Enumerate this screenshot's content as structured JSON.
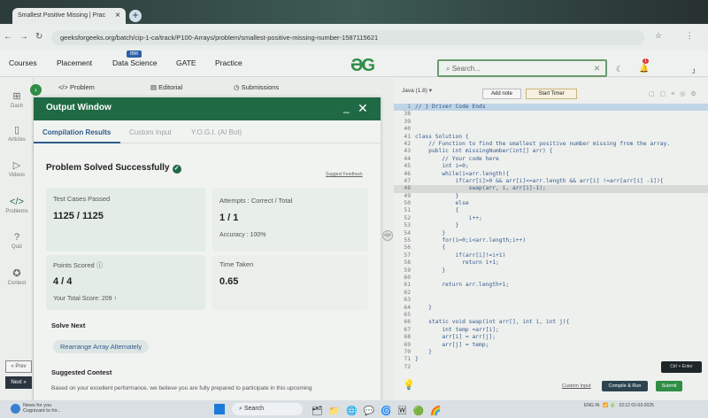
{
  "browser": {
    "tab_title": "Smallest Positive Missing | Prac",
    "url": "geeksforgeeks.org/batch/cip-1-ca/track/P100-Arrays/problem/smallest-positive-missing-number-1587115621"
  },
  "topnav": {
    "items": [
      "Courses",
      "Placement",
      "Data Science",
      "GATE",
      "Practice"
    ],
    "ibm_badge": "IBM",
    "logo": "ƏG",
    "search_placeholder": "Search...",
    "notif_count": "1",
    "avatar": "J"
  },
  "sidebar": {
    "items": [
      "Dash",
      "Articles",
      "Videos",
      "Problems",
      "Quiz",
      "Contest"
    ],
    "prev": "« Prev",
    "next": "Next »"
  },
  "problem_tabs": [
    "Problem",
    "Editorial",
    "Submissions"
  ],
  "output": {
    "title": "Output Window",
    "tabs": [
      "Compilation Results",
      "Custom Input",
      "Y.O.G.I. (AI Bot)"
    ],
    "status": "Problem Solved Successfully",
    "feedback": "Suggest Feedback",
    "test_cases_label": "Test Cases Passed",
    "test_cases": "1125 / 1125",
    "attempts_label": "Attempts : Correct / Total",
    "attempts": "1 / 1",
    "accuracy": "Accuracy : 100%",
    "points_label": "Points Scored",
    "points": "4 / 4",
    "total_score": "Your Total Score: 209 ↑",
    "time_label": "Time Taken",
    "time": "0.65",
    "solve_next": "Solve Next",
    "next_problem": "Rearrange Array Alternately",
    "suggested": "Suggested Contest",
    "suggested_text": "Based on your excellent performance, we believe you are fully prepared to participate in this upcoming"
  },
  "editor": {
    "language": "Java (1.8)",
    "add_note": "Add note",
    "start_timer": "Start Timer",
    "lines": [
      {
        "n": "1",
        "t": "// } Driver Code Ends"
      },
      {
        "n": "38",
        "t": ""
      },
      {
        "n": "39",
        "t": ""
      },
      {
        "n": "40",
        "t": ""
      },
      {
        "n": "41",
        "t": "class Solution {"
      },
      {
        "n": "42",
        "t": "    // Function to find the smallest positive number missing from the array."
      },
      {
        "n": "43",
        "t": "    public int missingNumber(int[] arr) {"
      },
      {
        "n": "44",
        "t": "        // Your code here"
      },
      {
        "n": "45",
        "t": "        int i=0;"
      },
      {
        "n": "46",
        "t": "        while(i<arr.length){"
      },
      {
        "n": "47",
        "t": "            if(arr[i]>0 && arr[i]<=arr.length && arr[i] !=arr[arr[i] -1]){"
      },
      {
        "n": "48",
        "t": "                swap(arr, i, arr[i]-1);"
      },
      {
        "n": "49",
        "t": "            }"
      },
      {
        "n": "50",
        "t": "            else"
      },
      {
        "n": "51",
        "t": "            {"
      },
      {
        "n": "52",
        "t": "                i++;"
      },
      {
        "n": "53",
        "t": "            }"
      },
      {
        "n": "54",
        "t": "        }"
      },
      {
        "n": "55",
        "t": "        for(i=0;i<arr.length;i++)"
      },
      {
        "n": "56",
        "t": "        {"
      },
      {
        "n": "57",
        "t": "            if(arr[i]!=i+1)"
      },
      {
        "n": "58",
        "t": "              return i+1;"
      },
      {
        "n": "59",
        "t": "        }"
      },
      {
        "n": "60",
        "t": ""
      },
      {
        "n": "61",
        "t": "        return arr.length+1;"
      },
      {
        "n": "62",
        "t": ""
      },
      {
        "n": "63",
        "t": ""
      },
      {
        "n": "64",
        "t": "    }"
      },
      {
        "n": "65",
        "t": ""
      },
      {
        "n": "66",
        "t": "    static void swap(int arr[], int i, int j){"
      },
      {
        "n": "67",
        "t": "        int temp =arr[i];"
      },
      {
        "n": "68",
        "t": "        arr[i] = arr[j];"
      },
      {
        "n": "69",
        "t": "        arr[j] = temp;"
      },
      {
        "n": "70",
        "t": "    }"
      },
      {
        "n": "71",
        "t": "}"
      },
      {
        "n": "72",
        "t": ""
      }
    ],
    "shortcut": "Ctrl + Enter",
    "custom_input": "Custom Input",
    "compile_run": "Compile & Run",
    "submit": "Submit"
  },
  "taskbar": {
    "news_title": "News for you",
    "news_sub": "Cognizant to hir...",
    "search": "Search",
    "lang": "ENG IN",
    "time": "22:12",
    "date": "02-03-2025"
  },
  "colors": {
    "brand_green": "#2f8d46",
    "header_green": "#1f6a44",
    "link_blue": "#2e5c8a"
  }
}
